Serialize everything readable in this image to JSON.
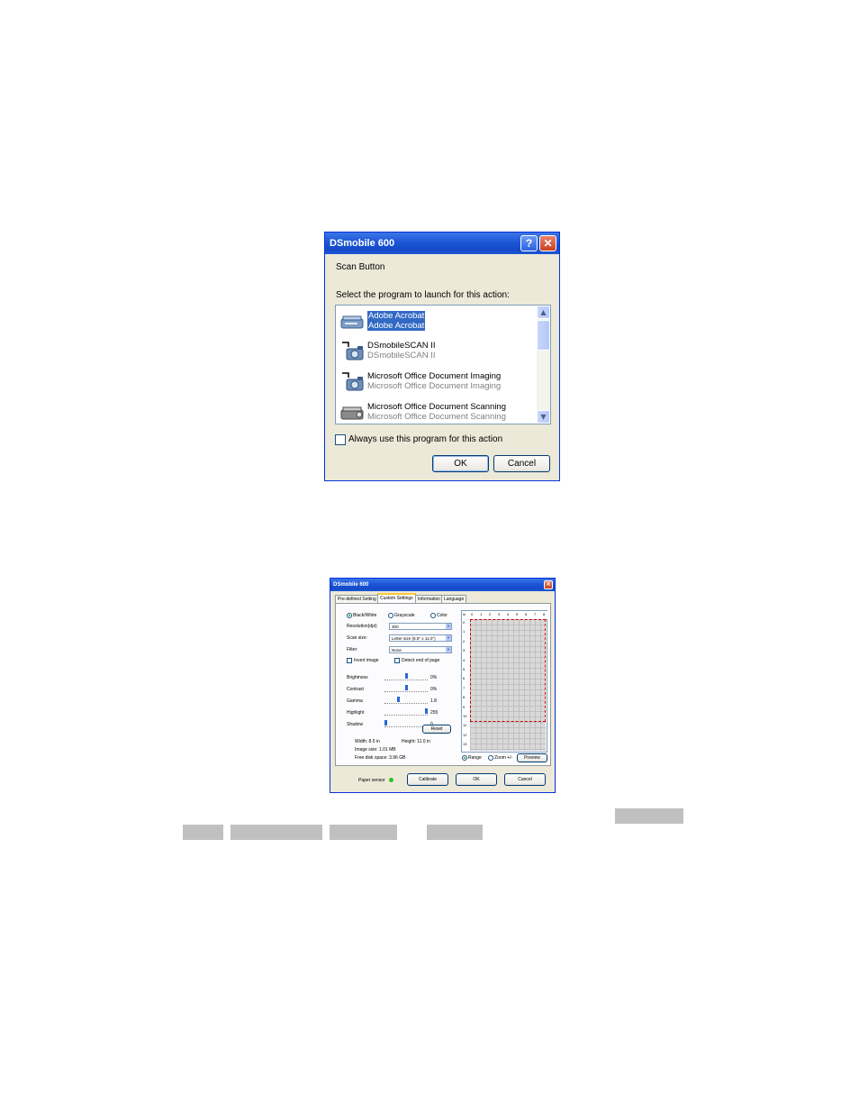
{
  "dialog1": {
    "title": "DSmobile 600",
    "help_symbol": "?",
    "close_symbol": "✕",
    "heading": "Scan Button",
    "prompt": "Select the program to launch for this action:",
    "programs": [
      {
        "name": "Adobe Acrobat",
        "sub": "Adobe Acrobat",
        "icon": "scanner-icon",
        "selected": true
      },
      {
        "name": "DSmobileSCAN II",
        "sub": "DSmobileSCAN II",
        "icon": "camera-icon",
        "selected": false
      },
      {
        "name": "Microsoft Office Document Imaging",
        "sub": "Microsoft Office Document Imaging",
        "icon": "camera-icon",
        "selected": false
      },
      {
        "name": "Microsoft Office Document Scanning",
        "sub": "Microsoft Office Document Scanning",
        "icon": "scanner-icon",
        "selected": false
      }
    ],
    "always_use_label": "Always use this program for this action",
    "ok_label": "OK",
    "cancel_label": "Cancel"
  },
  "dialog2": {
    "title": "DSmobile 600",
    "tabs": [
      "Pre-defined Setting",
      "Custom Settings",
      "Information",
      "Language"
    ],
    "active_tab": "Custom Settings",
    "color_modes": [
      "Black/White",
      "Grayscale",
      "Color"
    ],
    "selected_mode": "Black/White",
    "resolution_label": "Resolution(dpi)",
    "resolution_value": "300",
    "scan_size_label": "Scan size:",
    "scan_size_value": "Letter size (8.5\" x 11.0\")",
    "filter_label": "Filter:",
    "filter_value": "None",
    "invert_label": "Invert image",
    "detect_label": "Detect end of page",
    "sliders": [
      {
        "label": "Brightness",
        "value": "0%",
        "pos": 0.5
      },
      {
        "label": "Contrast",
        "value": "0%",
        "pos": 0.5
      },
      {
        "label": "Gamma",
        "value": "1.8",
        "pos": 0.3
      },
      {
        "label": "Highlight",
        "value": "255",
        "pos": 1.0
      },
      {
        "label": "Shadow",
        "value": "0",
        "pos": 0.0
      }
    ],
    "reset_label": "Reset",
    "width_text": "Width: 8.5 in",
    "height_text": "Height: 11.0 in",
    "image_size_text": "Image size: 1.01 MB",
    "free_disk_text": "Free disk space: 3.96 GB",
    "unit_label": "in",
    "ruler_top": [
      "0",
      "1",
      "2",
      "3",
      "4",
      "5",
      "6",
      "7",
      "8"
    ],
    "ruler_left": [
      "0",
      "1",
      "2",
      "3",
      "4",
      "5",
      "6",
      "7",
      "8",
      "9",
      "10",
      "11",
      "12",
      "13"
    ],
    "range_label": "Range",
    "zoom_label": "Zoom +/-",
    "preview_label": "Preview",
    "paper_sensor_label": "Paper sensor",
    "calibrate_label": "Calibrate",
    "ok_label": "OK",
    "cancel_label": "Cancel"
  },
  "colors": {
    "xp_blue": "#1c56d6",
    "dialog_bg": "#ece9d8",
    "selection": "#316ac5",
    "highlight_mark": "#c0c0c0",
    "sensor_led": "#2ec12e"
  }
}
